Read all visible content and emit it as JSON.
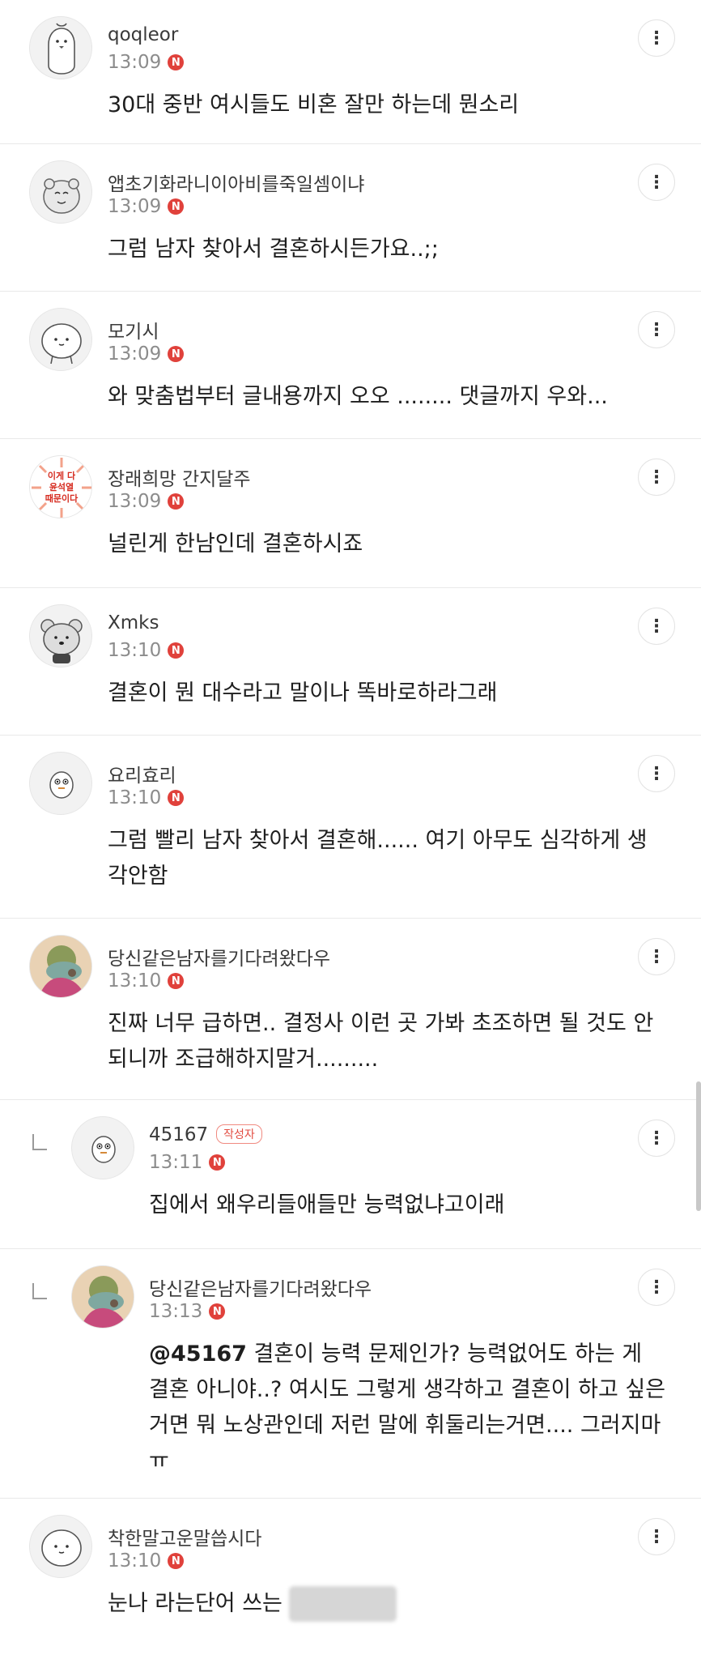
{
  "comments": [
    {
      "nick": "qoqleor",
      "time": "13:09",
      "text": "30대 중반 여시들도 비혼 잘만 하는데 뭔소리",
      "avatar_icon": "penguin-icon"
    },
    {
      "nick": "앱초기화라니이아비를죽일셈이냐",
      "time": "13:09",
      "text": "그럼 남자 찾아서 결혼하시든가요..;;",
      "avatar_icon": "character-icon"
    },
    {
      "nick": "모기시",
      "time": "13:09",
      "text": "와 맞춤법부터 글내용까지 오오 ........ 댓글까지 우와...",
      "avatar_icon": "character-icon"
    },
    {
      "nick": "장래희망 간지달주",
      "time": "13:09",
      "text": "널린게 한남인데 결혼하시죠",
      "avatar_text": "이게 다 윤석열 때문이다"
    },
    {
      "nick": "Xmks",
      "time": "13:10",
      "text": "결혼이 뭔 대수라고 말이나 똑바로하라그래",
      "avatar_icon": "bear-icon"
    },
    {
      "nick": "요리효리",
      "time": "13:10",
      "text": "그럼 빨리 남자 찾아서 결혼해...... 여기 아무도 심각하게 생각안함",
      "avatar_icon": "character-icon"
    },
    {
      "nick": "당신같은남자를기다려왔다우",
      "time": "13:10",
      "text": "진짜 너무 급하면.. 결정사 이런 곳 가봐 초조하면 될 것도 안 되니까 조급해하지말거.........",
      "avatar_icon": "illustration-icon"
    },
    {
      "nick": "45167",
      "badge": "작성자",
      "time": "13:11",
      "text": "집에서 왜우리들애들만 능력없냐고이래",
      "avatar_icon": "character-icon",
      "reply": true
    },
    {
      "nick": "당신같은남자를기다려왔다우",
      "time": "13:13",
      "mention": "@45167",
      "text": "결혼이 능력 문제인가? 능력없어도 하는 게 결혼 아니야..? 여시도 그렇게 생각하고 결혼이 하고 싶은 거면 뭐 노상관인데 저런 말에 휘둘리는거면.... 그러지마ㅠ",
      "avatar_icon": "illustration-icon",
      "reply": true
    },
    {
      "nick": "착한말고운말씁시다",
      "time": "13:10",
      "text": "눈나 라는단어 쓰는 한남 개싫어",
      "text_visible": "눈나 라는단어 쓰는",
      "avatar_icon": "character-icon"
    }
  ],
  "ui": {
    "new_badge": "N",
    "more": "⋮"
  },
  "colors": {
    "new_badge": "#e0413b",
    "author_badge": "#e24c41",
    "divider": "#e9e9e9"
  }
}
